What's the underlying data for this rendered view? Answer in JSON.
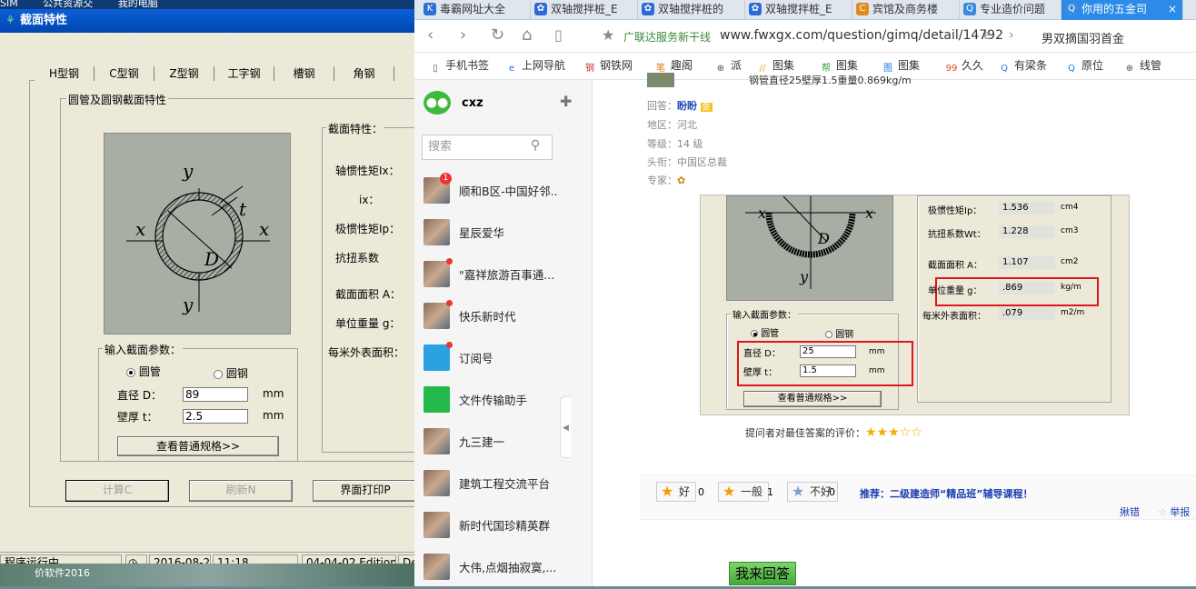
{
  "desktop": {
    "menubar": [
      "SIM",
      "公共资源交",
      "我的电脑"
    ],
    "taskbar_text": "价软件2016"
  },
  "app": {
    "title": "截面特性",
    "tabs": [
      "H型钢",
      "C型钢",
      "Z型钢",
      "工字钢",
      "槽钢",
      "角钢"
    ],
    "group_title": "圆管及圆钢截面特性",
    "diagram": {
      "y_top": "y",
      "y_bottom": "y",
      "x_left": "x",
      "x_right": "x",
      "t": "t",
      "d": "D"
    },
    "input_group_title": "输入截面参数：",
    "radio_pipe": "圆管",
    "radio_bar": "圆钢",
    "diameter_label": "直径 D：",
    "diameter_value": "89",
    "thickness_label": "壁厚 t：",
    "thickness_value": "2.5",
    "unit_mm": "mm",
    "spec_button": "查看普通规格>>",
    "props_title": "截面特性：",
    "props": [
      "轴惯性矩Ix：",
      "ix：",
      "极惯性矩Ip：",
      "抗扭系数",
      "截面面积 A：",
      "单位重量 g：",
      "每米外表面积："
    ],
    "buttons": {
      "calc": "计算C",
      "refresh": "刷新N",
      "print": "界面打印P"
    },
    "status": {
      "running": "程序运行中...",
      "date": "2016-08-20",
      "time": "11:18",
      "edition": "04-04-02 Edition",
      "extra": "De"
    }
  },
  "browser": {
    "tabs": [
      {
        "label": "毒霸网址大全",
        "color": "#2d6fd6",
        "icon": "K"
      },
      {
        "label": "双轴搅拌桩_E",
        "color": "#2f6ad8",
        "icon": "paw"
      },
      {
        "label": "双轴搅拌桩的",
        "color": "#2f6ad8",
        "icon": "paw"
      },
      {
        "label": "双轴搅拌桩_E",
        "color": "#2f6ad8",
        "icon": "paw"
      },
      {
        "label": "宾馆及商务楼",
        "color": "#e08a1c",
        "icon": "C"
      },
      {
        "label": "专业造价问题",
        "color": "#3a8be0",
        "icon": "Q"
      },
      {
        "label": "你用的五金司",
        "color": "#3a8be0",
        "icon": "Q"
      }
    ],
    "close_glyph": "×",
    "ad_text": "广联达服务新干线",
    "url": "www.fwxgx.com/question/gimq/detail/14792",
    "search_hint": "男双摘国羽首金",
    "bookmarks": [
      {
        "label": "手机书签",
        "icon": "▯",
        "color": "#555"
      },
      {
        "label": "上网导航",
        "icon": "e",
        "color": "#1a73e8"
      },
      {
        "label": "钢铁网",
        "icon": "钢",
        "color": "#c33"
      },
      {
        "label": "趣阁",
        "icon": "笔",
        "color": "#e07a10"
      },
      {
        "label": "派",
        "icon": "⊕",
        "color": "#555"
      },
      {
        "label": "图集",
        "icon": "//",
        "color": "#e0a010"
      },
      {
        "label": "图集",
        "icon": "帮",
        "color": "#3a9a3a"
      },
      {
        "label": "图集",
        "icon": "图",
        "color": "#1a7ad8"
      },
      {
        "label": "久久",
        "icon": "99",
        "color": "#e04a1a"
      },
      {
        "label": "有梁条",
        "icon": "Q",
        "color": "#2a7ad8"
      },
      {
        "label": "原位",
        "icon": "Q",
        "color": "#2a7ad8"
      },
      {
        "label": "线管",
        "icon": "⊕",
        "color": "#555"
      }
    ]
  },
  "wechat": {
    "user": "cxz",
    "search_placeholder": "搜索",
    "chats": [
      {
        "name": "顺和B区-中国好邻...",
        "badge": "1"
      },
      {
        "name": "星辰爱华",
        "badge": ""
      },
      {
        "name": "\"嘉祥旅游百事通...",
        "badge": "dot"
      },
      {
        "name": "快乐新时代",
        "badge": "dot"
      },
      {
        "name": "订阅号",
        "badge": "dot"
      },
      {
        "name": "文件传输助手",
        "badge": ""
      },
      {
        "name": "九三建一",
        "badge": ""
      },
      {
        "name": "建筑工程交流平台",
        "badge": ""
      },
      {
        "name": "新时代国珍精英群",
        "badge": ""
      },
      {
        "name": "大伟,点烟抽寂寞,...",
        "badge": ""
      }
    ]
  },
  "answer": {
    "top_text": "钢管直径25壁厚1.5重量0.869kg/m",
    "responder_label": "回答：",
    "responder": "盼盼",
    "region_label": "地区：",
    "region": "河北",
    "level_label": "等级：",
    "level": "14 级",
    "title_label": "头衔：",
    "title": "中国区总裁",
    "expert_label": "专家：",
    "shot": {
      "props": [
        {
          "label": "极惯性矩Ip：",
          "value": "1.536",
          "unit": "cm4"
        },
        {
          "label": "抗扭系数Wt：",
          "value": "1.228",
          "unit": "cm3"
        },
        {
          "label": "截面面积 A：",
          "value": "1.107",
          "unit": "cm2"
        },
        {
          "label": "单位重量 g：",
          "value": ".869",
          "unit": "kg/m"
        },
        {
          "label": "每米外表面积：",
          "value": ".079",
          "unit": "m2/m"
        }
      ],
      "input_title": "输入截面参数：",
      "radio_pipe": "圆管",
      "radio_bar": "圆钢",
      "d_label": "直径 D：",
      "d_value": "25",
      "t_label": "壁厚 t：",
      "t_value": "1.5",
      "unit": "mm",
      "spec_button": "查看普通规格>>"
    },
    "rating_label": "提问者对最佳答案的评价：",
    "rating_stars": 3,
    "rating_max": 5,
    "votes": [
      {
        "label": "好",
        "count": "0"
      },
      {
        "label": "一般",
        "count": "1"
      },
      {
        "label": "不好",
        "count": "0"
      }
    ],
    "recommend": "推荐：二级建造师“精品班”辅导课程！",
    "error_link": "揪错",
    "report_link": "举报",
    "answer_button": "我来回答"
  }
}
